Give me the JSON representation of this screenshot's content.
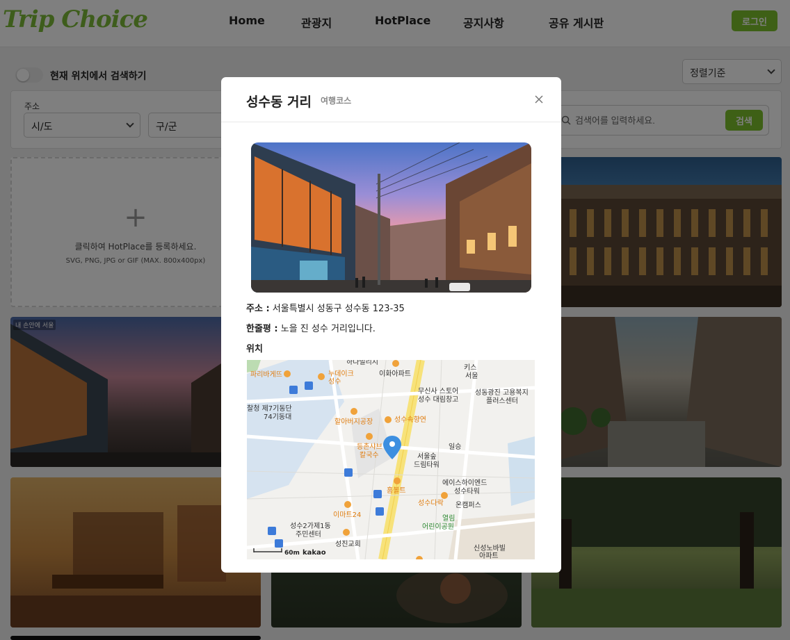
{
  "header": {
    "logo": "Trip Choice",
    "nav": [
      "Home",
      "관광지",
      "HotPlace",
      "공지사항",
      "공유 게시판"
    ],
    "login_label": "로그인"
  },
  "filters": {
    "location_toggle_label": "현재 위치에서 검색하기",
    "sort_label": "정렬기준",
    "address_label": "주소",
    "sido_label": "시/도",
    "gugun_label": "구/군",
    "search_placeholder": "검색어를 입력하세요.",
    "search_button": "검색"
  },
  "upload_card": {
    "plus": "+",
    "text": "클릭하여 HotPlace를 등록하세요.",
    "subtext": "SVG, PNG, JPG or GIF (MAX. 800x400px)"
  },
  "cards": [
    {
      "tag": "내 손안에 서울"
    }
  ],
  "modal": {
    "title": "성수동 거리",
    "category": "여행코스",
    "address_label": "주소 :",
    "address": "서울특별시 성동구 성수동 123-35",
    "review_label": "한줄평 :",
    "review": "노을 진 성수 거리입니다.",
    "location_label": "위치"
  },
  "map": {
    "scale": "60m",
    "brand": "kakao",
    "labels": [
      "하나빌리지",
      "이화아파트",
      "키스",
      "서울",
      "파리바게뜨",
      "누데이크",
      "성수",
      "무신사 스토어",
      "성수 대림창고",
      "성동광진 고용복지",
      "플러스센터",
      "할아버지공장",
      "성수속향연",
      "등촌샤브",
      "칼국수",
      "일승",
      "서울숲",
      "드림타워",
      "에이스하이엔드",
      "성수타워",
      "홈볼트",
      "성수다락",
      "온캠퍼스",
      "이마트24",
      "성수2가제1동",
      "주민센터",
      "열림",
      "어린이공원",
      "성진교회",
      "신성노바빌",
      "아파트",
      "찰청 제7기동단",
      "74기동대"
    ]
  },
  "colors": {
    "accent": "#7cc02d",
    "logo": "#7dbb38",
    "overlay": "rgba(0,0,0,0.5)"
  }
}
